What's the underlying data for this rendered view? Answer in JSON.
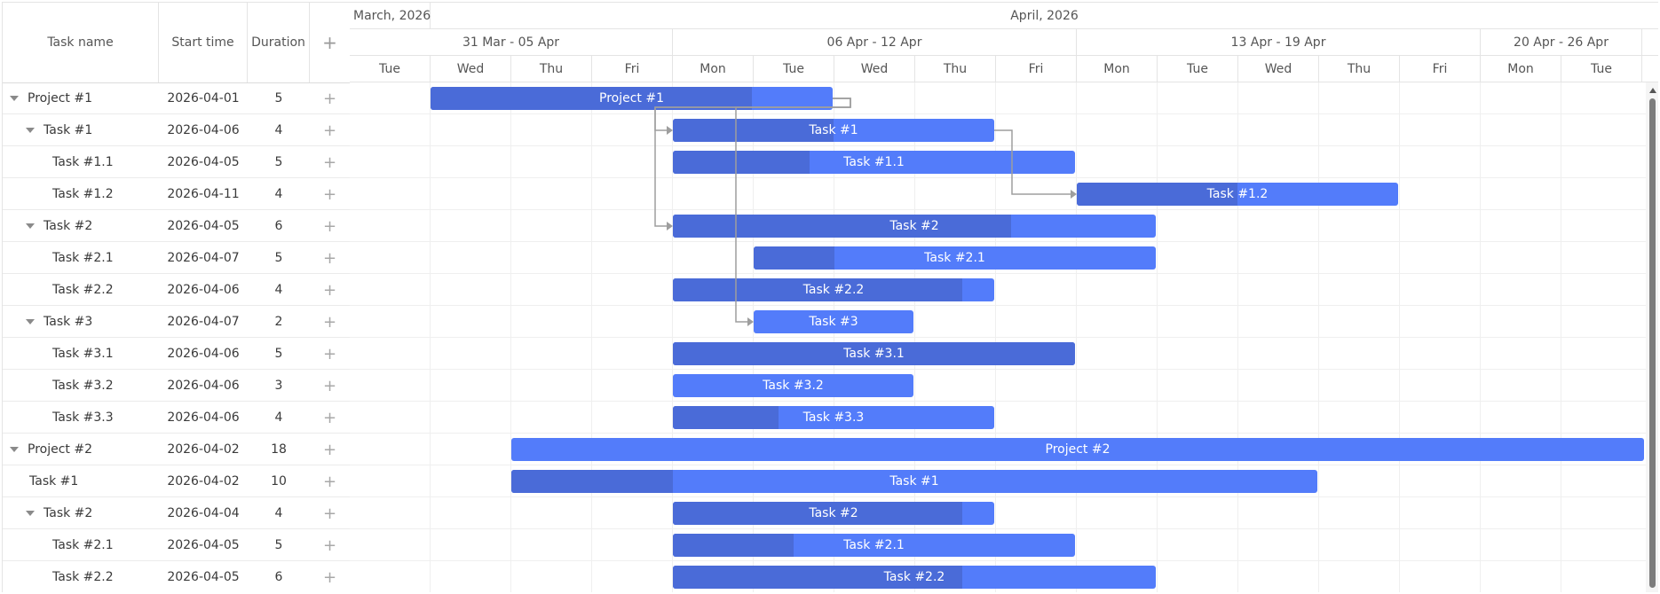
{
  "grid": {
    "columns": {
      "name": "Task name",
      "start": "Start time",
      "duration": "Duration",
      "add": "+"
    },
    "add_icon": "plus-icon",
    "toggle_icon": "caret-down-icon"
  },
  "scale": {
    "months": [
      {
        "label": "March, 2026",
        "days": 1
      },
      {
        "label": "April, 2026",
        "days": 18
      }
    ],
    "weeks": [
      {
        "label": "31 Mar - 05 Apr",
        "days": 4
      },
      {
        "label": "06 Apr - 12 Apr",
        "days": 5
      },
      {
        "label": "13 Apr - 19 Apr",
        "days": 5
      },
      {
        "label": "20 Apr - 26 Apr",
        "days": 2
      }
    ],
    "days": [
      "Tue",
      "Wed",
      "Thu",
      "Fri",
      "Mon",
      "Tue",
      "Wed",
      "Thu",
      "Fri",
      "Mon",
      "Tue",
      "Wed",
      "Thu",
      "Fri",
      "Mon",
      "Tue"
    ],
    "day_dates": [
      "2026-03-31",
      "2026-04-01",
      "2026-04-02",
      "2026-04-03",
      "2026-04-06",
      "2026-04-07",
      "2026-04-08",
      "2026-04-09",
      "2026-04-10",
      "2026-04-13",
      "2026-04-14",
      "2026-04-15",
      "2026-04-16",
      "2026-04-17",
      "2026-04-20",
      "2026-04-21"
    ]
  },
  "colors": {
    "bar": "#537cfa",
    "progress": "#4a6bd8",
    "link": "#9e9e9e"
  },
  "tasks": [
    {
      "id": "p1",
      "name": "Project #1",
      "start": "2026-04-01",
      "duration": "5",
      "level": 0,
      "toggle": true,
      "progress": 0.8
    },
    {
      "id": "p1t1",
      "name": "Task #1",
      "start": "2026-04-06",
      "duration": "4",
      "level": 1,
      "toggle": true,
      "progress": 0.5
    },
    {
      "id": "p1t11",
      "name": "Task #1.1",
      "start": "2026-04-05",
      "duration": "5",
      "level": 2,
      "toggle": false,
      "progress": 0.34
    },
    {
      "id": "p1t12",
      "name": "Task #1.2",
      "start": "2026-04-11",
      "duration": "4",
      "level": 2,
      "toggle": false,
      "progress": 0.5
    },
    {
      "id": "p1t2",
      "name": "Task #2",
      "start": "2026-04-05",
      "duration": "6",
      "level": 1,
      "toggle": true,
      "progress": 0.7
    },
    {
      "id": "p1t21",
      "name": "Task #2.1",
      "start": "2026-04-07",
      "duration": "5",
      "level": 2,
      "toggle": false,
      "progress": 0.2
    },
    {
      "id": "p1t22",
      "name": "Task #2.2",
      "start": "2026-04-06",
      "duration": "4",
      "level": 2,
      "toggle": false,
      "progress": 0.9
    },
    {
      "id": "p1t3",
      "name": "Task #3",
      "start": "2026-04-07",
      "duration": "2",
      "level": 1,
      "toggle": true,
      "progress": 0
    },
    {
      "id": "p1t31",
      "name": "Task #3.1",
      "start": "2026-04-06",
      "duration": "5",
      "level": 2,
      "toggle": false,
      "progress": 1
    },
    {
      "id": "p1t32",
      "name": "Task #3.2",
      "start": "2026-04-06",
      "duration": "3",
      "level": 2,
      "toggle": false,
      "progress": 0
    },
    {
      "id": "p1t33",
      "name": "Task #3.3",
      "start": "2026-04-06",
      "duration": "4",
      "level": 2,
      "toggle": false,
      "progress": 0.33
    },
    {
      "id": "p2",
      "name": "Project #2",
      "start": "2026-04-02",
      "duration": "18",
      "level": 0,
      "toggle": true,
      "progress": 0
    },
    {
      "id": "p2t1",
      "name": "Task #1",
      "start": "2026-04-02",
      "duration": "10",
      "level": 1,
      "toggle": false,
      "progress": 0.2
    },
    {
      "id": "p2t2",
      "name": "Task #2",
      "start": "2026-04-04",
      "duration": "4",
      "level": 1,
      "toggle": true,
      "progress": 0.9
    },
    {
      "id": "p2t21",
      "name": "Task #2.1",
      "start": "2026-04-05",
      "duration": "5",
      "level": 2,
      "toggle": false,
      "progress": 0.3
    },
    {
      "id": "p2t22",
      "name": "Task #2.2",
      "start": "2026-04-05",
      "duration": "6",
      "level": 2,
      "toggle": false,
      "progress": 0.6
    }
  ],
  "links": [
    {
      "from": "p1",
      "to": "p1t1"
    },
    {
      "from": "p1",
      "to": "p1t2"
    },
    {
      "from": "p1",
      "to": "p1t3"
    },
    {
      "from": "p1t1",
      "to": "p1t12"
    }
  ]
}
